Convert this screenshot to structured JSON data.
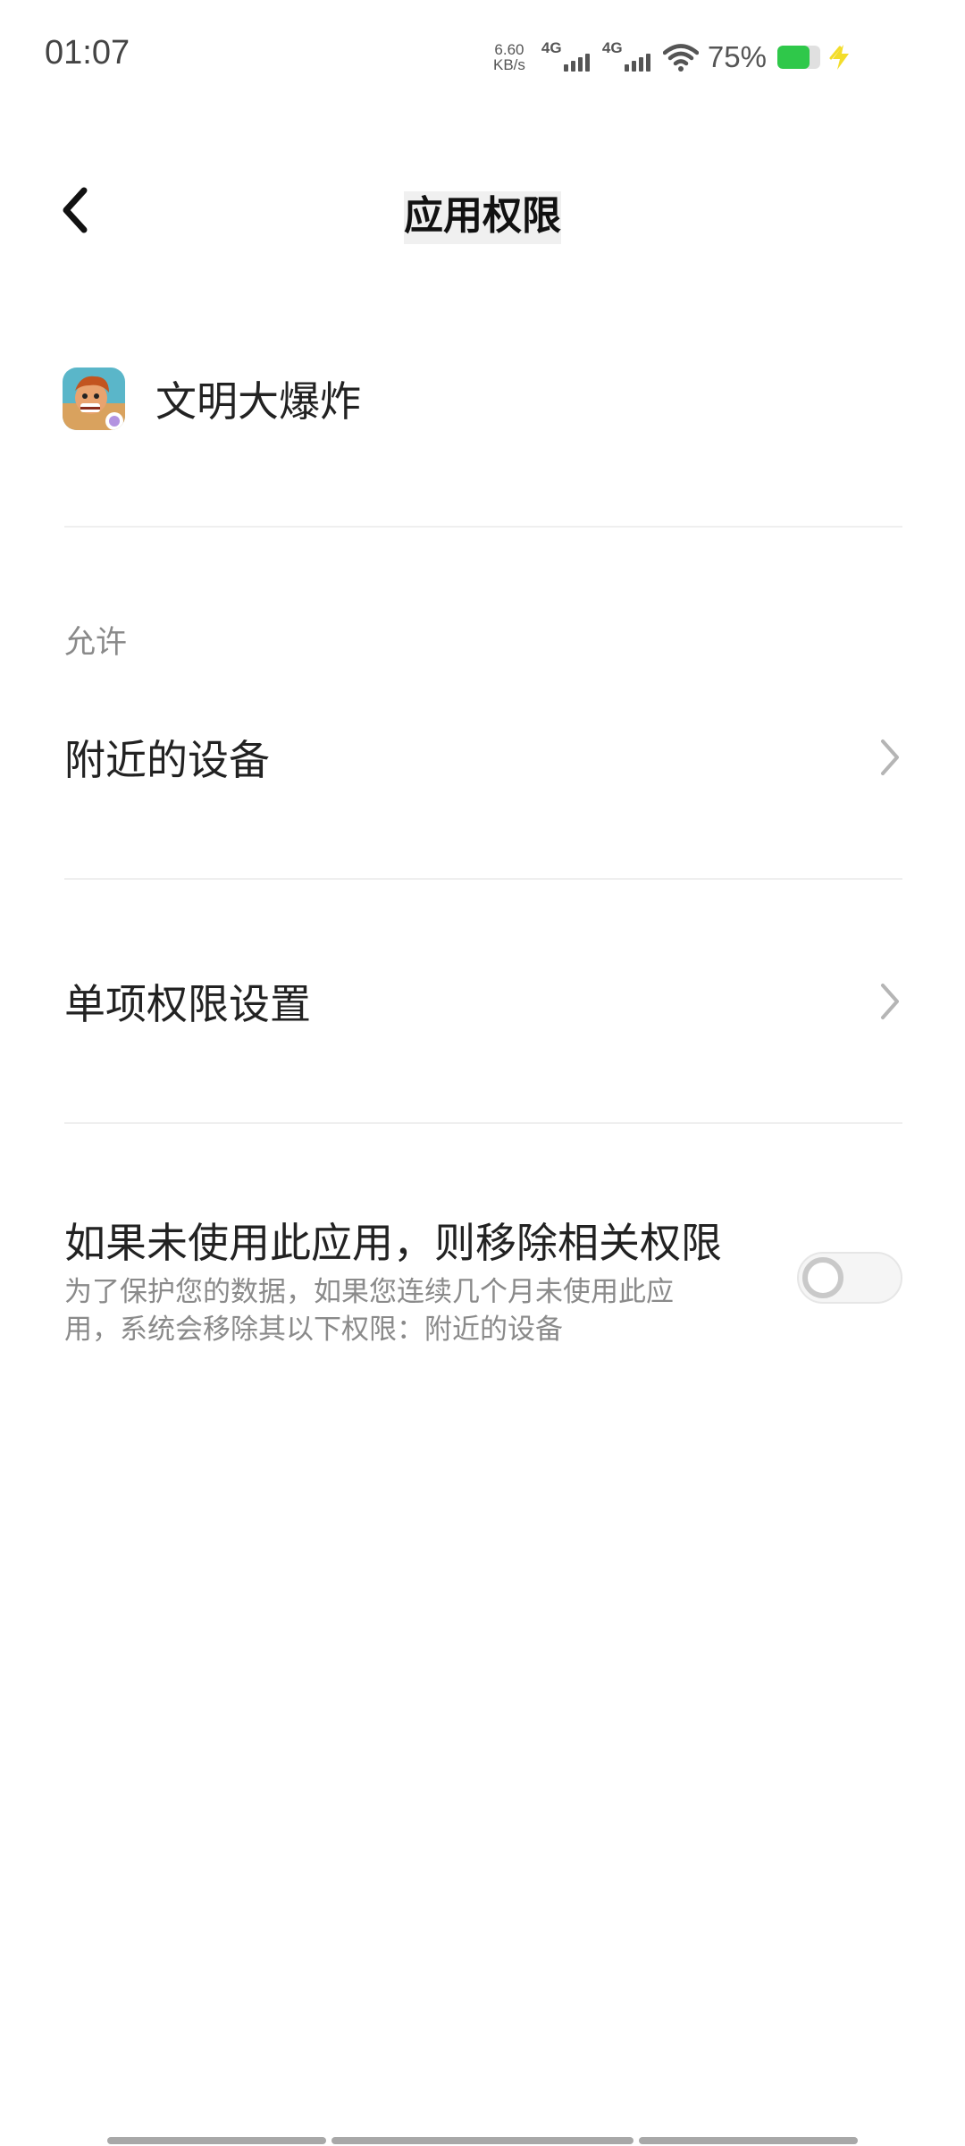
{
  "status_bar": {
    "time": "01:07",
    "net_speed_value": "6.60",
    "net_speed_unit": "KB/s",
    "sim1_label": "4G",
    "sim2_label": "4G",
    "battery_percent": "75%",
    "battery_level": 0.75,
    "wifi_icon": "wifi-icon",
    "charging_icon": "bolt-icon",
    "battery_color": "#2fc84a"
  },
  "header": {
    "back_icon": "chevron-left-icon",
    "title": "应用权限"
  },
  "app": {
    "name": "文明大爆炸",
    "icon": "app-icon"
  },
  "section": {
    "allowed_label": "允许"
  },
  "rows": [
    {
      "label": "附近的设备",
      "icon": "chevron-right-icon"
    },
    {
      "label": "单项权限设置",
      "icon": "chevron-right-icon"
    }
  ],
  "auto_revoke": {
    "title": "如果未使用此应用，则移除相关权限",
    "description": "为了保护您的数据，如果您连续几个月未使用此应用，系统会移除其以下权限：附近的设备",
    "enabled": false
  }
}
